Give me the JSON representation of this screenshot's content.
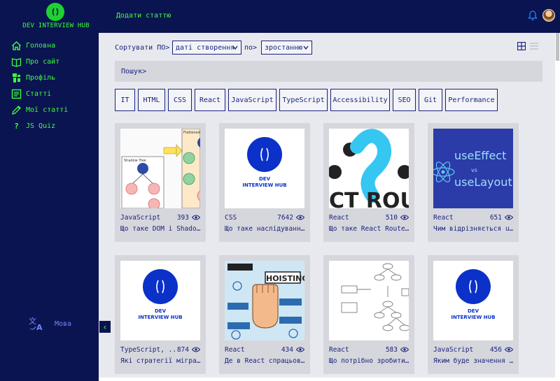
{
  "app": {
    "logo_text": "DEV INTERVIEW HUB",
    "add_article": "Додати статтю"
  },
  "sidebar": {
    "items": [
      {
        "label": "Головна",
        "icon": "home-icon"
      },
      {
        "label": "Про сайт",
        "icon": "book-icon"
      },
      {
        "label": "Профіль",
        "icon": "person-icon"
      },
      {
        "label": "Статті",
        "icon": "article-icon"
      },
      {
        "label": "Мої статті",
        "icon": "pencil-icon"
      },
      {
        "label": "JS Quiz",
        "icon": "question-icon",
        "glyph": "?"
      }
    ],
    "language": "Мова",
    "collapse": "‹"
  },
  "sort": {
    "label": "Сортувати ПО>",
    "field": "даті створення",
    "by_label": "по>",
    "order": "зростанню"
  },
  "search": {
    "placeholder": "Пошук>"
  },
  "tags": [
    "IT",
    "HTML",
    "CSS",
    "React",
    "JavaScript",
    "TypeScript",
    "Accessibility",
    "SEO",
    "Git",
    "Performance"
  ],
  "cards": [
    {
      "category": "JavaScript",
      "views": "393",
      "title": "Що таке DOM і Shadow DOM?",
      "thumb": "shadow-tree"
    },
    {
      "category": "CSS",
      "views": "7642",
      "title": "Що таке наслідування у CSS?",
      "thumb": "dev-logo"
    },
    {
      "category": "React",
      "views": "510",
      "title": "Що таке React Router?",
      "thumb": "react-router",
      "thumb_text": "CT ROU"
    },
    {
      "category": "React",
      "views": "651",
      "title": "Чим відрізняється useEffect від useLayoutEffect?",
      "thumb": "use-effect",
      "thumb_lines": [
        "useEffect",
        "vs",
        "useLayout"
      ]
    },
    {
      "category": "TypeScript, ...",
      "views": "874",
      "title": "Які стратегії міграції на TypeScript?",
      "thumb": "dev-logo"
    },
    {
      "category": "React",
      "views": "434",
      "title": "Де в React спрацьовує hoisting?",
      "thumb": "hoisting",
      "thumb_text": "HOISTING"
    },
    {
      "category": "React",
      "views": "583",
      "title": "Що потрібно зробити, щоб оновити Virtual DOM?",
      "thumb": "virtual-dom"
    },
    {
      "category": "JavaScript",
      "views": "456",
      "title": "Яким буде значення змінної?",
      "thumb": "dev-logo"
    }
  ],
  "dev_logo": {
    "line1": "DEV",
    "line2": "INTERVIEW HUB"
  },
  "colors": {
    "navy": "#0a1450",
    "green": "#3dff3d",
    "card": "#d6d7dc",
    "main_bg": "#e8e9ee",
    "brand_blue": "#0b31c9"
  }
}
